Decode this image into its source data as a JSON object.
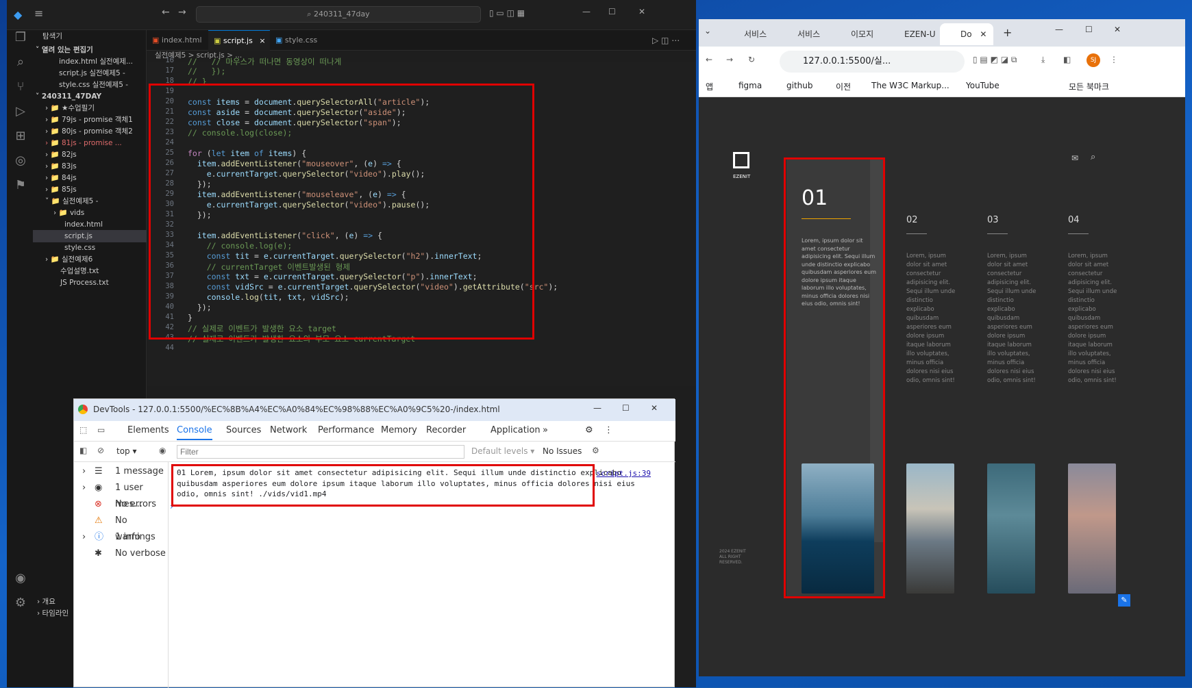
{
  "vscode": {
    "search": "240311_47day",
    "tabs": [
      "index.html",
      "script.js",
      "style.css"
    ],
    "breadcrumb": "실전예제5 > script.js > ...",
    "explorer_title": "탐색기",
    "open_editors": "열려 있는 편집기",
    "open_files": [
      "index.html 실전예제...",
      "script.js 실전예제5 -",
      "style.css 실전예제5 -"
    ],
    "project": "240311_47DAY",
    "tree": [
      "★수업필기",
      "79js - promise 객체1",
      "80js - promise 객체2",
      "81js - promise ...",
      "82js",
      "83js",
      "84js",
      "85js",
      "실전예제5 -",
      "vids",
      "index.html",
      "script.js",
      "style.css",
      "실전예제6",
      "수업설명.txt",
      "JS Process.txt"
    ],
    "outline": "개요",
    "timeline": "타임라인",
    "line_numbers": [
      "16",
      "17",
      "18",
      "19",
      "20",
      "21",
      "22",
      "23",
      "24",
      "25",
      "26",
      "27",
      "28",
      "29",
      "30",
      "31",
      "32",
      "33",
      "34",
      "35",
      "36",
      "37",
      "38",
      "39",
      "40",
      "41",
      "42",
      "43",
      "44"
    ]
  },
  "browser": {
    "tabs": [
      "서비스",
      "서비스",
      "이모지",
      "EZEN-U",
      "Do"
    ],
    "url": "127.0.0.1:5500/실...",
    "bookmarks": [
      "앱",
      "figma",
      "github",
      "이전",
      "The W3C Markup...",
      "YouTube",
      "모든 북마크"
    ],
    "logo": "EZENIT",
    "columns": [
      {
        "num": "01",
        "text": "Lorem, ipsum dolor sit amet consectetur adipisicing elit. Sequi illum unde distinctio explicabo quibusdam asperiores eum dolore ipsum itaque laborum illo voluptates, minus officia dolores nisi eius odio, omnis sint!"
      },
      {
        "num": "02",
        "text": "Lorem, ipsum dolor sit amet consectetur adipisicing elit. Sequi illum unde distinctio explicabo quibusdam asperiores eum dolore ipsum itaque laborum illo voluptates, minus officia dolores nisi eius odio, omnis sint!"
      },
      {
        "num": "03",
        "text": "Lorem, ipsum dolor sit amet consectetur adipisicing elit. Sequi illum unde distinctio explicabo quibusdam asperiores eum dolore ipsum itaque laborum illo voluptates, minus officia dolores nisi eius odio, omnis sint!"
      },
      {
        "num": "04",
        "text": "Lorem, ipsum dolor sit amet consectetur adipisicing elit. Sequi illum unde distinctio explicabo quibusdam asperiores eum dolore ipsum itaque laborum illo voluptates, minus officia dolores nisi eius odio, omnis sint!"
      }
    ],
    "copyright": "2024 EZENIT ALL RIGHT RESERVED."
  },
  "devtools": {
    "title": "DevTools - 127.0.0.1:5500/%EC%8B%A4%EC%A0%84%EC%98%88%EC%A0%9C5%20-/index.html",
    "tabs": [
      "Elements",
      "Console",
      "Sources",
      "Network",
      "Performance",
      "Memory",
      "Recorder",
      "Application"
    ],
    "context": "top",
    "filter_placeholder": "Filter",
    "levels": "Default levels",
    "issues": "No Issues",
    "sidebar": [
      "1 message",
      "1 user mes...",
      "No errors",
      "No warnings",
      "1 info",
      "No verbose"
    ],
    "log": "01 Lorem, ipsum dolor sit amet consectetur adipisicing elit. Sequi illum unde distinctio explicabo quibusdam asperiores eum dolore ipsum itaque laborum illo voluptates, minus officia dolores nisi eius odio, omnis sint! ./vids/vid1.mp4",
    "source": "script.js:39"
  }
}
